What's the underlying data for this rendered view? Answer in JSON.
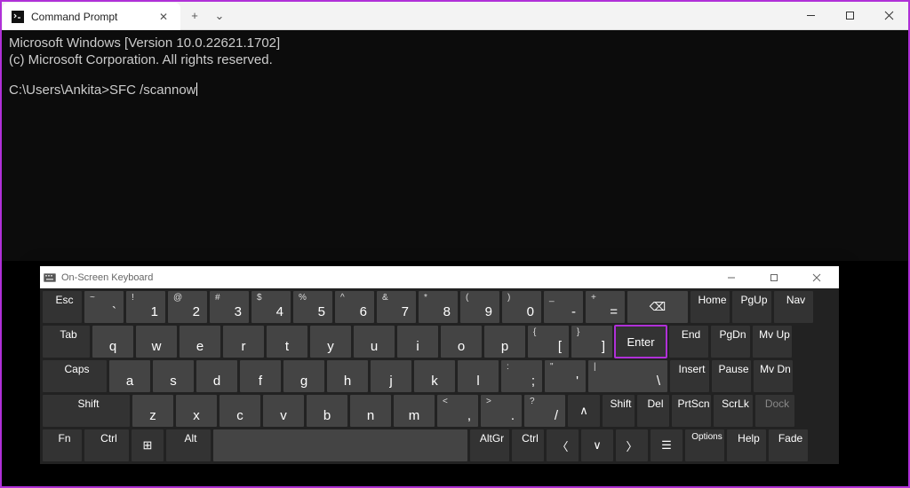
{
  "window": {
    "tab_title": "Command Prompt",
    "add_tab": "+",
    "dropdown": "⌄"
  },
  "terminal": {
    "line1": "Microsoft Windows [Version 10.0.22621.1702]",
    "line2": "(c) Microsoft Corporation. All rights reserved.",
    "prompt": "C:\\Users\\Ankita>",
    "input": "SFC /scannow"
  },
  "osk": {
    "title": "On-Screen Keyboard",
    "row1": {
      "esc": "Esc",
      "tilde_u": "~",
      "tilde_l": "`",
      "k1_u": "!",
      "k1_l": "1",
      "k2_u": "@",
      "k2_l": "2",
      "k3_u": "#",
      "k3_l": "3",
      "k4_u": "$",
      "k4_l": "4",
      "k5_u": "%",
      "k5_l": "5",
      "k6_u": "^",
      "k6_l": "6",
      "k7_u": "&",
      "k7_l": "7",
      "k8_u": "*",
      "k8_l": "8",
      "k9_u": "(",
      "k9_l": "9",
      "k0_u": ")",
      "k0_l": "0",
      "dash_u": "_",
      "dash_l": "-",
      "eq_u": "+",
      "eq_l": "=",
      "bksp": "⌫",
      "home": "Home",
      "pgup": "PgUp",
      "nav": "Nav"
    },
    "row2": {
      "tab": "Tab",
      "q": "q",
      "w": "w",
      "e": "e",
      "r": "r",
      "t": "t",
      "y": "y",
      "u": "u",
      "i": "i",
      "o": "o",
      "p": "p",
      "br1_u": "{",
      "br1_l": "[",
      "br2_u": "}",
      "br2_l": "]",
      "enter": "Enter",
      "end": "End",
      "pgdn": "PgDn",
      "mvup": "Mv Up"
    },
    "row3": {
      "caps": "Caps",
      "a": "a",
      "s": "s",
      "d": "d",
      "f": "f",
      "g": "g",
      "h": "h",
      "j": "j",
      "k": "k",
      "l": "l",
      "semi_u": ":",
      "semi_l": ";",
      "apos_u": "\"",
      "apos_l": "'",
      "bsl_u": "|",
      "bsl_l": "\\",
      "ins": "Insert",
      "pause": "Pause",
      "mvdn": "Mv Dn"
    },
    "row4": {
      "shiftL": "Shift",
      "z": "z",
      "x": "x",
      "c": "c",
      "v": "v",
      "b": "b",
      "n": "n",
      "m": "m",
      "com_u": "<",
      "com_l": ",",
      "dot_u": ">",
      "dot_l": ".",
      "sl_u": "?",
      "sl_l": "/",
      "up": "∧",
      "shiftR": "Shift",
      "del": "Del",
      "prt": "PrtScn",
      "scr": "ScrLk",
      "dock": "Dock"
    },
    "row5": {
      "fn": "Fn",
      "ctrlL": "Ctrl",
      "win": "⊞",
      "alt": "Alt",
      "space": "",
      "altgr": "AltGr",
      "ctrlR": "Ctrl",
      "left": "〈",
      "down": "∨",
      "right": "〉",
      "menu": "☰",
      "opt": "Options",
      "help": "Help",
      "fade": "Fade"
    }
  }
}
